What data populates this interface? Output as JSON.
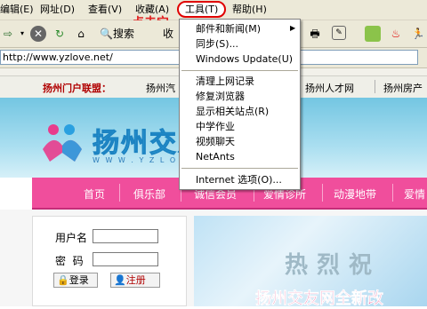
{
  "menubar": {
    "items": [
      "编辑(E)",
      "网址(D)",
      "查看(V)",
      "收藏(A)",
      "工具(T)",
      "帮助(H)"
    ],
    "annotation": "点击它"
  },
  "toolbar": {
    "back_glyph": "⇨",
    "search_label": "搜索",
    "fav_label": "收"
  },
  "address": {
    "url": "http://www.yzlove.net/"
  },
  "portal": {
    "title": "扬州门户联盟：",
    "links": [
      "扬州汽",
      "扬州人才网",
      "扬州房产"
    ]
  },
  "site": {
    "logo_text": "扬州交友",
    "logo_sub": "W W W . Y Z L O V E . N"
  },
  "nav": {
    "items": [
      "首页",
      "俱乐部",
      "诚信会员",
      "爱情诊所",
      "动漫地带",
      "爱情"
    ]
  },
  "login": {
    "username_label": "用户名",
    "password_label": "密  码",
    "login_button": "登录",
    "register_button": "注册"
  },
  "banner": {
    "big_text": "热烈祝",
    "red_text": "扬州交友网全新改"
  },
  "dropdown": {
    "items": [
      "邮件和新闻(M)",
      "同步(S)...",
      "Windows Update(U)",
      "清理上网记录",
      "修复浏览器",
      "显示相关站点(R)",
      "中学作业",
      "视频聊天",
      "NetAnts",
      "Internet 选项(O)..."
    ],
    "submenu_arrow": "▶"
  }
}
